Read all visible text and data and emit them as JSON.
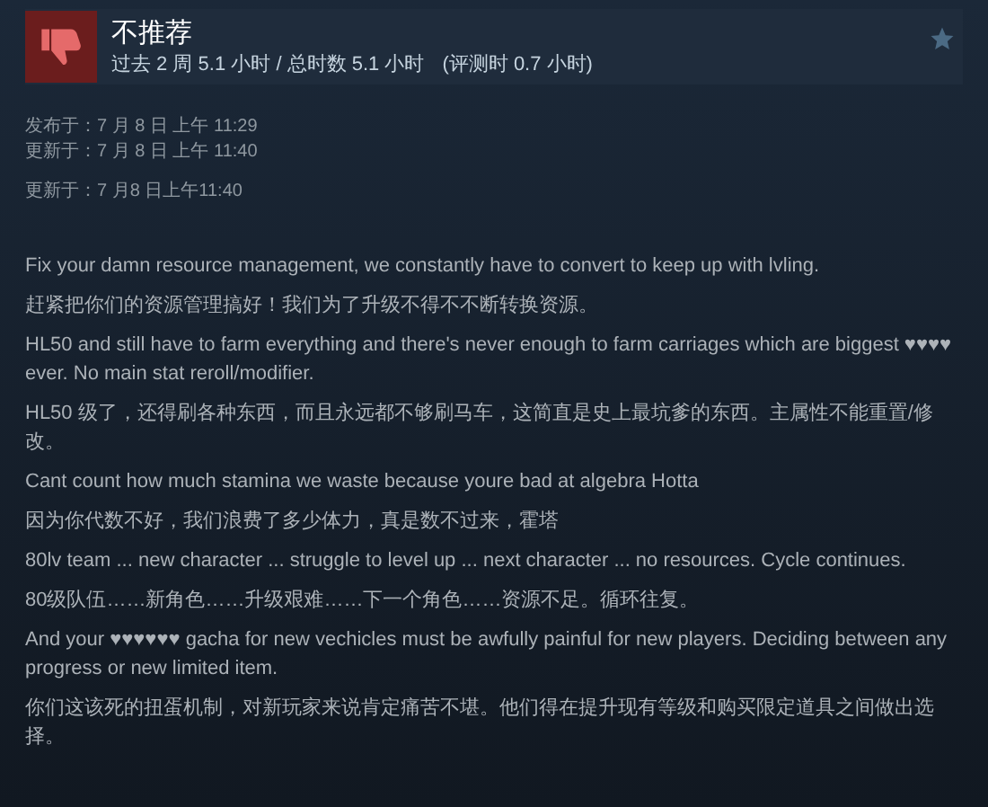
{
  "review": {
    "verdict": "不推荐",
    "recommended": false,
    "playtime": "过去 2 周 5.1 小时 / 总时数 5.1 小时",
    "playtime_at_review": "(评测时 0.7 小时)"
  },
  "dates": [
    "发布于：7 月 8 日 上午 11:29",
    "更新于：7 月 8 日 上午 11:40"
  ],
  "updated_note": "更新于：7 月8 日上午11:40",
  "paragraphs": [
    "Fix your damn resource management, we constantly have to convert to keep up with lvling.",
    "赶紧把你们的资源管理搞好！我们为了升级不得不不断转换资源。",
    "HL50 and still have to farm everything and there's never enough to farm carriages which are biggest ♥♥♥♥ ever. No main stat reroll/modifier.",
    "HL50 级了，还得刷各种东西，而且永远都不够刷马车，这简直是史上最坑爹的东西。主属性不能重置/修改。",
    "Cant count how much stamina we waste because youre bad at algebra Hotta",
    "因为你代数不好，我们浪费了多少体力，真是数不过来，霍塔",
    "80lv team ... new character ... struggle to level up ... next character ... no resources. Cycle continues.",
    "80级队伍……新角色……升级艰难……下一个角色……资源不足。循环往复。",
    "And your ♥♥♥♥♥♥ gacha for new vechicles must be awfully painful for new players. Deciding between any progress or new limited item.",
    "你们这该死的扭蛋机制，对新玩家来说肯定痛苦不堪。他们得在提升现有等级和购买限定道具之间做出选择。"
  ]
}
